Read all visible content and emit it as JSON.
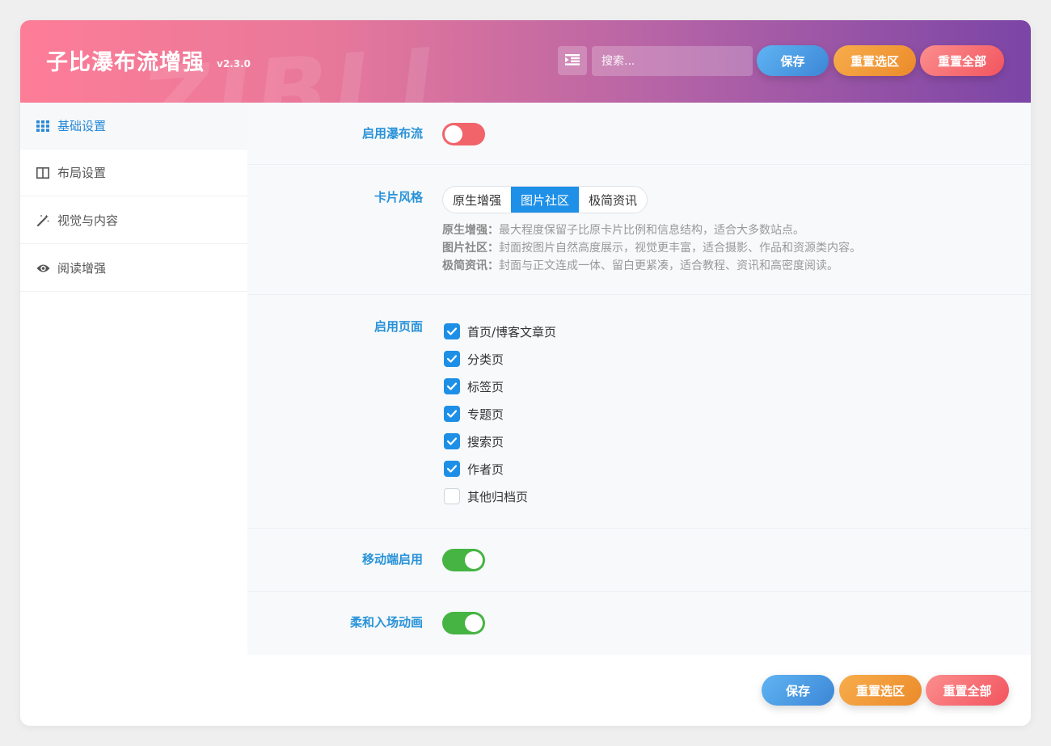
{
  "header": {
    "title": "子比瀑布流增强",
    "version": "v2.3.0",
    "watermark": "ZIBLL",
    "search_placeholder": "搜索...",
    "save_label": "保存",
    "reset_section_label": "重置选区",
    "reset_all_label": "重置全部"
  },
  "sidebar": {
    "items": [
      {
        "label": "基础设置",
        "icon": "grid-icon",
        "active": true
      },
      {
        "label": "布局设置",
        "icon": "columns-icon",
        "active": false
      },
      {
        "label": "视觉与内容",
        "icon": "magic-wand-icon",
        "active": false
      },
      {
        "label": "阅读增强",
        "icon": "eye-icon",
        "active": false
      }
    ]
  },
  "settings": {
    "waterfall": {
      "label": "启用瀑布流",
      "enabled": false
    },
    "card_style": {
      "label": "卡片风格",
      "options": [
        "原生增强",
        "图片社区",
        "极简资讯"
      ],
      "selected": "图片社区",
      "descriptions": [
        {
          "name": "原生增强：",
          "text": "最大程度保留子比原卡片比例和信息结构，适合大多数站点。"
        },
        {
          "name": "图片社区：",
          "text": "封面按图片自然高度展示，视觉更丰富，适合摄影、作品和资源类内容。"
        },
        {
          "name": "极简资讯：",
          "text": "封面与正文连成一体、留白更紧凑，适合教程、资讯和高密度阅读。"
        }
      ]
    },
    "pages": {
      "label": "启用页面",
      "items": [
        {
          "label": "首页/博客文章页",
          "checked": true
        },
        {
          "label": "分类页",
          "checked": true
        },
        {
          "label": "标签页",
          "checked": true
        },
        {
          "label": "专题页",
          "checked": true
        },
        {
          "label": "搜索页",
          "checked": true
        },
        {
          "label": "作者页",
          "checked": true
        },
        {
          "label": "其他归档页",
          "checked": false
        }
      ]
    },
    "mobile": {
      "label": "移动端启用",
      "enabled": true
    },
    "animation": {
      "label": "柔和入场动画",
      "enabled": true
    }
  },
  "footer": {
    "save_label": "保存",
    "reset_section_label": "重置选区",
    "reset_all_label": "重置全部"
  },
  "colors": {
    "accent": "#1e90e8",
    "label": "#2a93d8",
    "toggle_on": "#46b442",
    "toggle_off": "#f0646a"
  }
}
